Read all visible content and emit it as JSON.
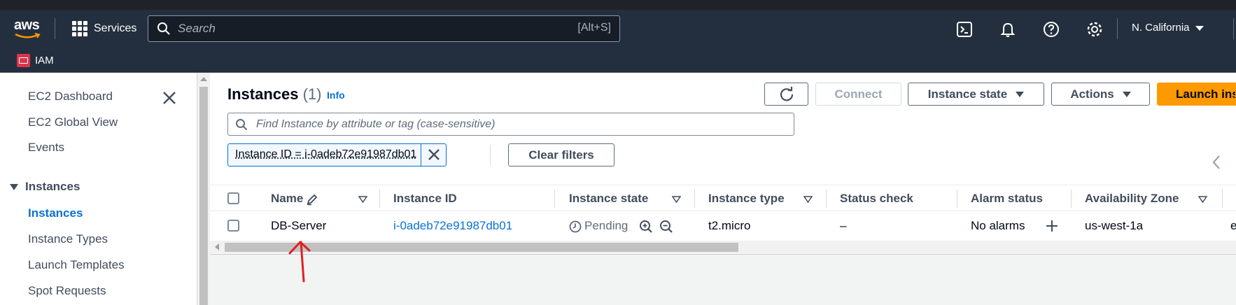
{
  "topnav": {
    "logo": "aws",
    "services_label": "Services",
    "search_placeholder": "Search",
    "search_shortcut": "[Alt+S]",
    "icons": [
      "cloudshell-icon",
      "bell-icon",
      "help-icon",
      "gear-icon"
    ],
    "region": "N. California",
    "colors": {
      "nav_bg": "#232f3e",
      "accent": "#ff9900"
    }
  },
  "service_bar": {
    "favorite": "IAM"
  },
  "sidebar": {
    "items": [
      "EC2 Dashboard",
      "EC2 Global View",
      "Events"
    ],
    "section": "Instances",
    "section_items": [
      "Instances",
      "Instance Types",
      "Launch Templates",
      "Spot Requests"
    ],
    "active_item": "Instances"
  },
  "main": {
    "title": "Instances",
    "count": "(1)",
    "info": "Info",
    "buttons": {
      "connect": "Connect",
      "instance_state": "Instance state",
      "actions": "Actions",
      "launch": "Launch ins"
    },
    "filter_placeholder": "Find Instance by attribute or tag (case-sensitive)",
    "token": "Instance ID = i-0adeb72e91987db01",
    "clear_filters": "Clear filters"
  },
  "table": {
    "columns": [
      "Name",
      "Instance ID",
      "Instance state",
      "Instance type",
      "Status check",
      "Alarm status",
      "Availability Zone"
    ],
    "rows": [
      {
        "name": "DB-Server",
        "instance_id": "i-0adeb72e91987db01",
        "state": "Pending",
        "type": "t2.micro",
        "status_check": "–",
        "alarm_status": "No alarms",
        "az": "us-west-1a",
        "overflow": "e"
      }
    ]
  }
}
